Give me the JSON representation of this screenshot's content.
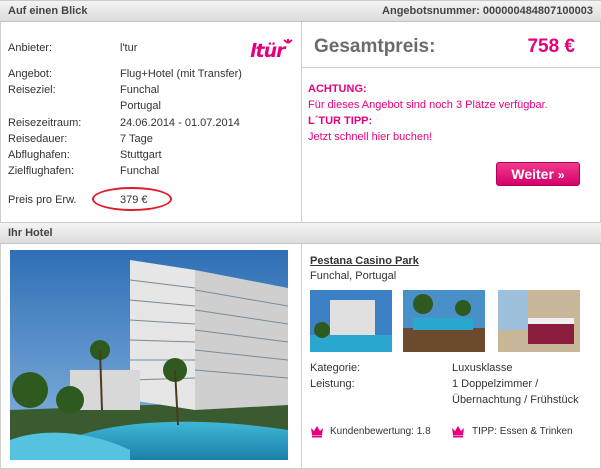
{
  "header": {
    "title": "Auf einen Blick",
    "offer_number": "Angebotsnummer: 000000484807100003"
  },
  "offer": {
    "provider_label": "Anbieter:",
    "provider_value": "l'tur",
    "logo_text": "ltür",
    "angebot_label": "Angebot:",
    "angebot_value": "Flug+Hotel (mit Transfer)",
    "reiseziel_label": "Reiseziel:",
    "reiseziel_value1": "Funchal",
    "reiseziel_value2": "Portugal",
    "zeitraum_label": "Reisezeitraum:",
    "zeitraum_value": "24.06.2014 - 01.07.2014",
    "dauer_label": "Reisedauer:",
    "dauer_value": "7 Tage",
    "abflug_label": "Abflughafen:",
    "abflug_value": "Stuttgart",
    "ziel_label": "Zielflughafen:",
    "ziel_value": "Funchal",
    "preis_label": "Preis pro Erw.",
    "preis_value": "379 €"
  },
  "pricebox": {
    "title": "Gesamtpreis:",
    "value": "758 €",
    "achtung": "ACHTUNG:",
    "achtung_text": "Für dieses Angebot sind noch 3 Plätze verfügbar.",
    "tipp": "L´TUR TIPP:",
    "tipp_text": "Jetzt schnell hier buchen!",
    "button": "Weiter",
    "button_chev": "»"
  },
  "hotel_section": {
    "title": "Ihr Hotel"
  },
  "hotel": {
    "name": "Pestana Casino Park",
    "location": "Funchal, Portugal",
    "kategorie_label": "Kategorie:",
    "kategorie_value": "Luxusklasse",
    "leistung_label": "Leistung:",
    "leistung_value1": "1 Doppelzimmer /",
    "leistung_value2": "Übernachtung / Frühstück",
    "bewertung": "Kundenbewertung: 1.8",
    "tipp": "TIPP: Essen & Trinken"
  },
  "colors": {
    "accent": "#e6007e",
    "circle": "#e21b2b"
  },
  "icons": {
    "rating": "crown-icon",
    "tip": "crown-icon",
    "button": "chevron-double-right-icon"
  }
}
